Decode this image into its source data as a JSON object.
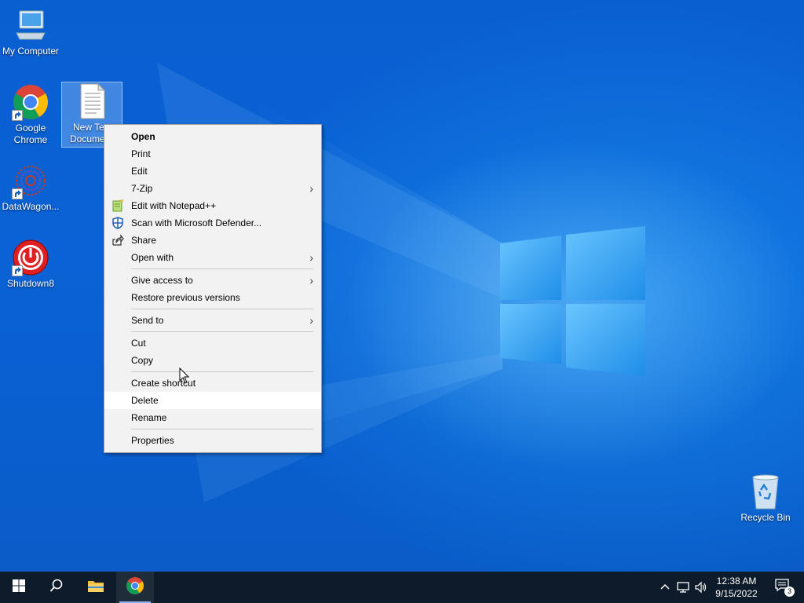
{
  "desktop": {
    "icons": [
      {
        "label": "My Computer"
      },
      {
        "label": "Google Chrome"
      },
      {
        "label": "New Text Document"
      },
      {
        "label": "DataWagon..."
      },
      {
        "label": "Shutdown8"
      },
      {
        "label": "Recycle Bin"
      }
    ],
    "selected_label_line1": "New Te",
    "selected_label_line2": "Docume"
  },
  "context_menu": {
    "items": [
      {
        "label": "Open"
      },
      {
        "label": "Print"
      },
      {
        "label": "Edit"
      },
      {
        "label": "7-Zip"
      },
      {
        "label": "Edit with Notepad++"
      },
      {
        "label": "Scan with Microsoft Defender..."
      },
      {
        "label": "Share"
      },
      {
        "label": "Open with"
      },
      {
        "label": "Give access to"
      },
      {
        "label": "Restore previous versions"
      },
      {
        "label": "Send to"
      },
      {
        "label": "Cut"
      },
      {
        "label": "Copy"
      },
      {
        "label": "Create shortcut"
      },
      {
        "label": "Delete"
      },
      {
        "label": "Rename"
      },
      {
        "label": "Properties"
      }
    ],
    "hovered_item": "Delete"
  },
  "taskbar": {
    "start_icon": "windows-logo-icon",
    "search_icon": "search-icon",
    "pinned": [
      "file-explorer-icon",
      "chrome-icon"
    ],
    "clock_time": "12:38 AM",
    "clock_date": "9/15/2022",
    "notification_count": "3"
  },
  "colors": {
    "wallpaper": "#0a5cc8",
    "taskbar": "#0d1b2a",
    "menu_bg": "#f2f2f2",
    "menu_hover": "#ffffff"
  }
}
